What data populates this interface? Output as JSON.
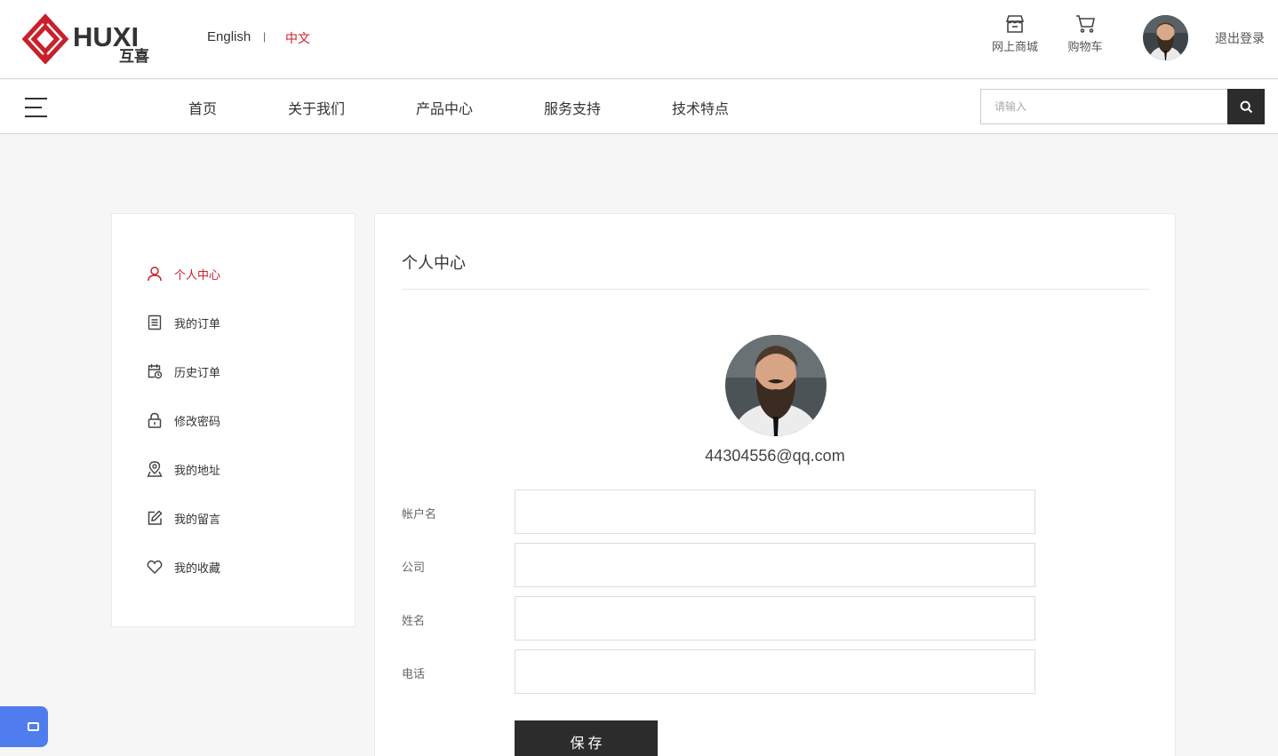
{
  "header": {
    "brand_text": "HUXI",
    "brand_cn": "互喜",
    "lang_en": "English",
    "lang_sep": "|",
    "lang_zh": "中文",
    "shop_label": "网上商城",
    "cart_label": "购物车",
    "logout_label": "退出登录",
    "accent_color": "#c9202c"
  },
  "nav": {
    "items": [
      "首页",
      "关于我们",
      "产品中心",
      "服务支持",
      "技术特点"
    ],
    "search_placeholder": "请输入"
  },
  "sidebar": {
    "items": [
      {
        "label": "个人中心",
        "icon": "user-icon",
        "active": true
      },
      {
        "label": "我的订单",
        "icon": "order-list-icon",
        "active": false
      },
      {
        "label": "历史订单",
        "icon": "calendar-clock-icon",
        "active": false
      },
      {
        "label": "修改密码",
        "icon": "lock-icon",
        "active": false
      },
      {
        "label": "我的地址",
        "icon": "location-pin-icon",
        "active": false
      },
      {
        "label": "我的留言",
        "icon": "edit-icon",
        "active": false
      },
      {
        "label": "我的收藏",
        "icon": "heart-icon",
        "active": false
      }
    ]
  },
  "main": {
    "title": "个人中心",
    "email": "44304556@qq.com",
    "form": {
      "account_label": "帐户名",
      "account_value": "",
      "company_label": "公司",
      "company_value": "",
      "name_label": "姓名",
      "name_value": "",
      "phone_label": "电话",
      "phone_value": ""
    },
    "save_label": "保存"
  }
}
